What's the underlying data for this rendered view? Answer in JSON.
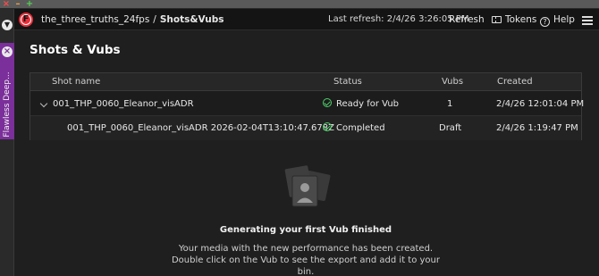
{
  "header": {
    "project": "the_three_truths_24fps",
    "separator": "/",
    "current_page": "Shots&Vubs",
    "last_refresh": "Last refresh: 2/4/26 3:26:05 PM",
    "refresh_label": "Refresh",
    "tokens_label": "Tokens",
    "help_label": "Help"
  },
  "side_panel": {
    "tab_label": "Flawless Deep..."
  },
  "page": {
    "title": "Shots & Vubs"
  },
  "table": {
    "columns": [
      "Shot name",
      "Status",
      "Vubs",
      "Created"
    ],
    "rows": [
      {
        "shot_name": "001_THP_0060_Eleanor_visADR",
        "status": "Ready for Vub",
        "vubs": "1",
        "created": "2/4/26 12:01:04 PM"
      },
      {
        "shot_name": "001_THP_0060_Eleanor_visADR 2026-02-04T13:10:47.678Z",
        "status": "Completed",
        "vubs": "Draft",
        "created": "2/4/26 1:19:47 PM"
      }
    ]
  },
  "empty_state": {
    "title": "Generating your first Vub finished",
    "body": "Your media with the new performance has been created. Double click on the Vub to see the export and add it to your bin."
  },
  "colors": {
    "accent_red": "#e8303a",
    "side_tab_purple": "#7b2f9a",
    "status_green": "#4fd06a"
  }
}
